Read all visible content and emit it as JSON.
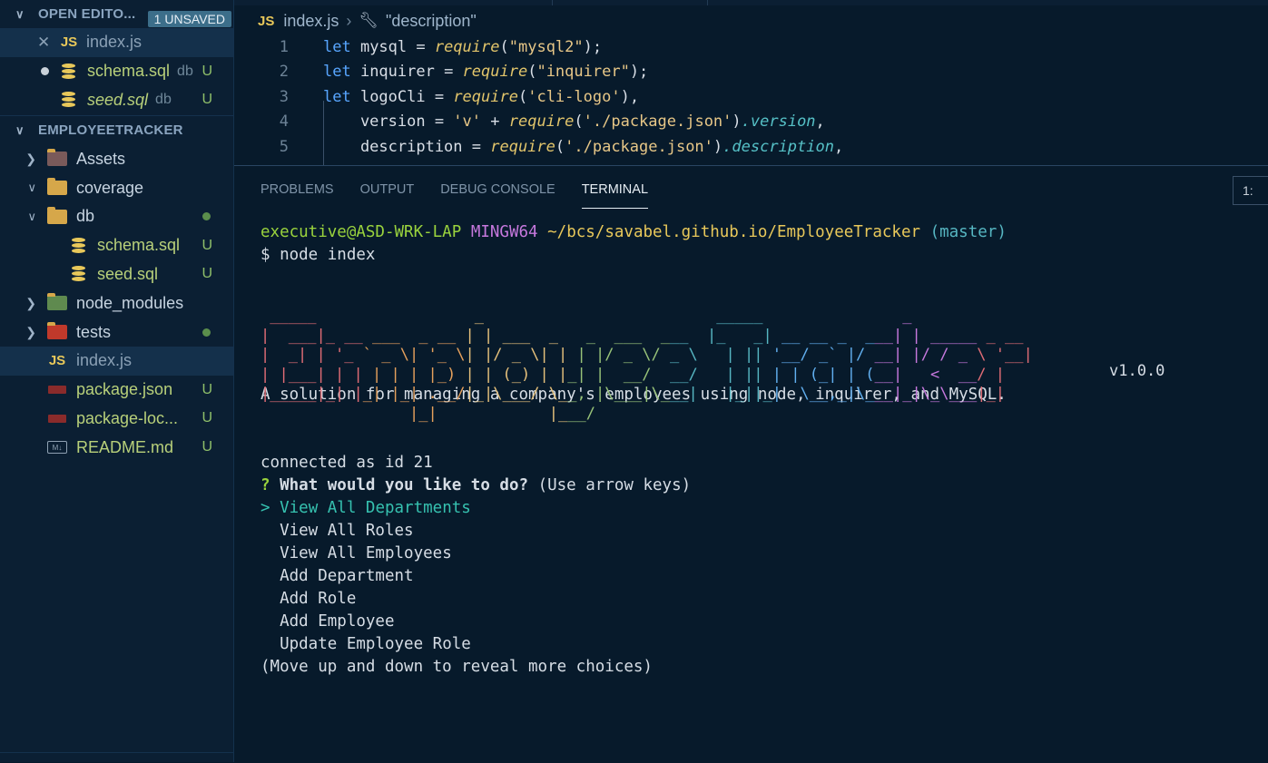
{
  "sidebar": {
    "open_editors": {
      "title": "OPEN EDITO...",
      "badge": "1 UNSAVED",
      "items": [
        {
          "label": "index.js",
          "sub": "",
          "status": "",
          "icon": "js-icon"
        },
        {
          "label": "schema.sql",
          "sub": "db",
          "status": "U",
          "icon": "database-icon"
        },
        {
          "label": "seed.sql",
          "sub": "db",
          "status": "U",
          "icon": "database-icon"
        }
      ]
    },
    "project": {
      "title": "EMPLOYEETRACKER",
      "items": [
        {
          "label": "Assets",
          "status": ""
        },
        {
          "label": "coverage",
          "status": ""
        },
        {
          "label": "db",
          "status": ""
        },
        {
          "label": "schema.sql",
          "status": "U"
        },
        {
          "label": "seed.sql",
          "status": "U"
        },
        {
          "label": "node_modules",
          "status": ""
        },
        {
          "label": "tests",
          "status": ""
        },
        {
          "label": "index.js",
          "status": ""
        },
        {
          "label": "package.json",
          "status": "U"
        },
        {
          "label": "package-loc...",
          "status": "U"
        },
        {
          "label": "README.md",
          "status": "U"
        }
      ]
    }
  },
  "breadcrumb": {
    "file": "index.js",
    "symbol": "\"description\""
  },
  "code": {
    "lines": [
      {
        "n": "1"
      },
      {
        "n": "2"
      },
      {
        "n": "3"
      },
      {
        "n": "4"
      },
      {
        "n": "5"
      }
    ],
    "tokens": {
      "let": "let",
      "mysql": " mysql = ",
      "inquirer": " inquirer = ",
      "logoCli": " logoCli = ",
      "require": "require",
      "s_mysql2": "\"mysql2\"",
      "s_inquirer": "\"inquirer\"",
      "s_clilogo": "'cli-logo'",
      "version_lhs": "    version = ",
      "s_v": "'v'",
      "plus": " + ",
      "s_pkg": "'./package.json'",
      "dot_version": ".version",
      "description_lhs": "    description = ",
      "dot_description": ".description",
      "close_semi": ");",
      "close_comma": "),",
      "comma": ","
    }
  },
  "panel": {
    "tabs": [
      "PROBLEMS",
      "OUTPUT",
      "DEBUG CONSOLE",
      "TERMINAL"
    ],
    "active_tab": "TERMINAL",
    "terminal_selector": "1:"
  },
  "terminal": {
    "user_host": "executive@ASD-WRK-LAP",
    "env": "MINGW64",
    "path": "~/bcs/savabel.github.io/EmployeeTracker",
    "branch": "(master)",
    "command": "$ node index",
    "ascii_art": " _____                 _                         _____               _             \n|  ___|_ __ ___  _ __ | | ___  _   _  ___  ___  |_   _| __ __ _  ___| | _____ _ __ \n|  _| | '_ ` _ \\| '_ \\| |/ _ \\| | | |/ _ \\/ _ \\   | || '__/ _` |/ __| |/ / _ \\ '__|\n| |___| | | | | | |_) | | (_) | |_| |  __/  __/   | || | | (_| | (__|   <  __/ |   \n|_____|_| |_| |_| .__/|_|\\___/ \\__, |\\___|\\___|   |_||_|  \\__,_|\\___|_|\\_\\___|_|   \n                |_|            |___/                                                ",
    "version": "v1.0.0",
    "description": "A solution for managing a company's employees using node, inquirer, and MySQL.",
    "connected": "connected as id 21",
    "question_mark": "?",
    "question": "What would you like to do?",
    "hint": "(Use arrow keys)",
    "pointer": ">",
    "choices": [
      "View All Departments",
      "View All Roles",
      "View All Employees",
      "Add Department",
      "Add Role",
      "Add Employee",
      "Update Employee Role"
    ],
    "footer": "(Move up and down to reveal more choices)"
  },
  "colors": {
    "background": "#071a2b",
    "sidebar": "#0b1f33",
    "prompt_green": "#9ad33d",
    "prompt_purple": "#c678dd",
    "path_yellow": "#e8c85a",
    "branch_cyan": "#56b6c2",
    "selected_choice": "#36c2b0"
  }
}
